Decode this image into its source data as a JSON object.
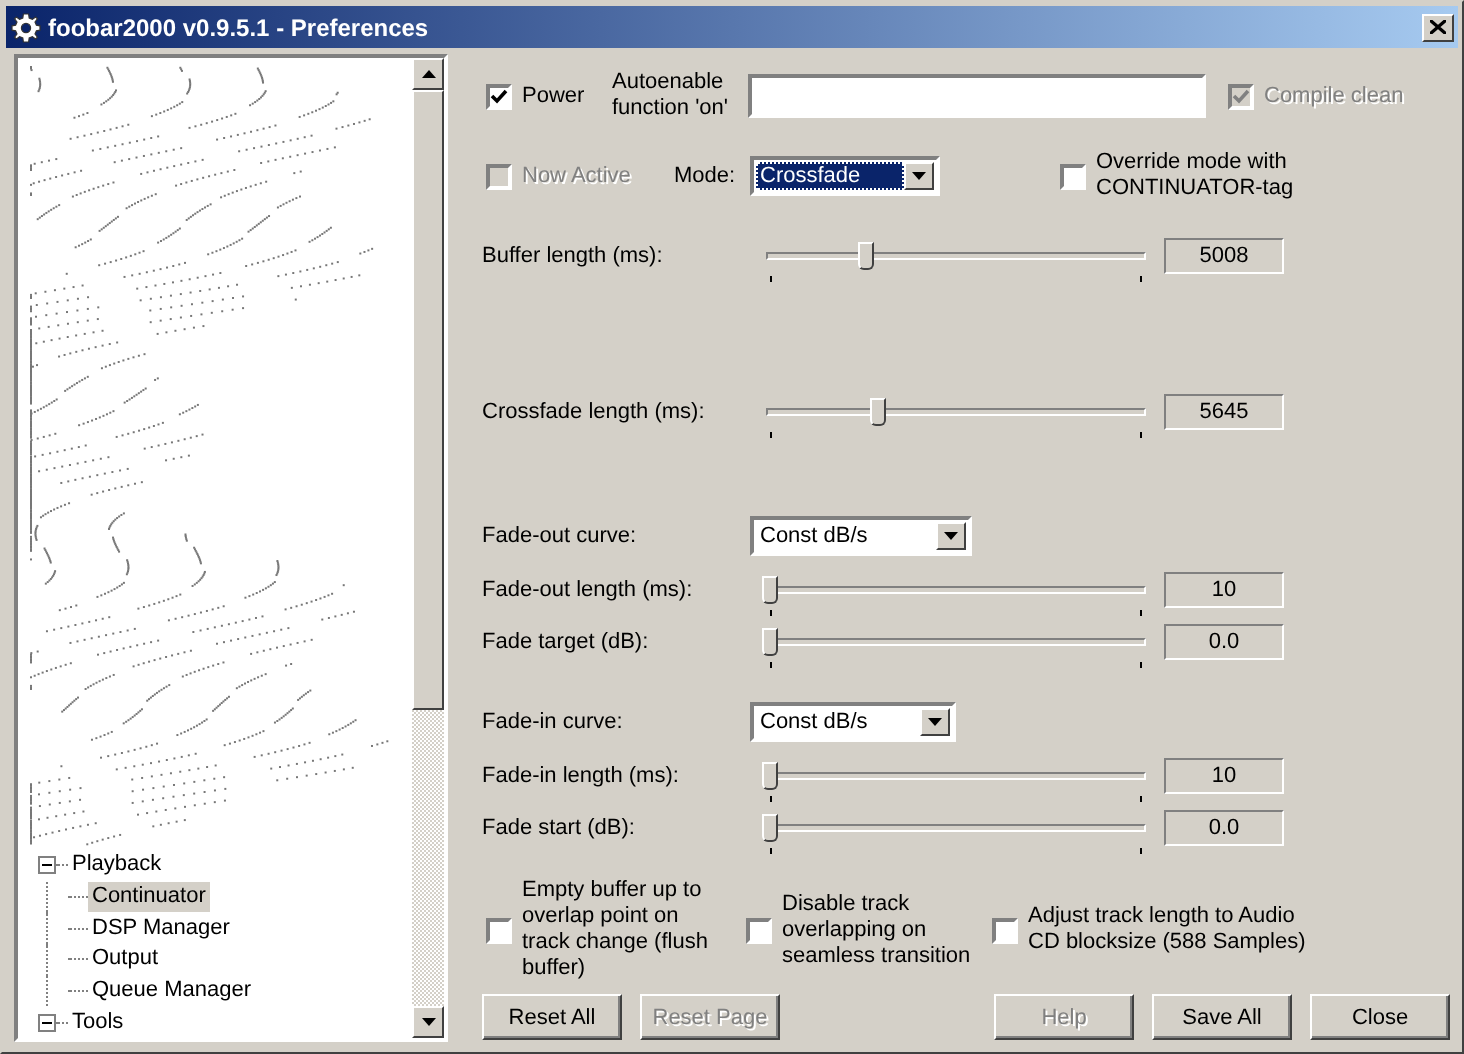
{
  "window": {
    "title": "foobar2000 v0.9.5.1 - Preferences"
  },
  "tree": [
    {
      "label": "Playback",
      "expanded": true,
      "selected": false,
      "children": [
        {
          "label": "Continuator",
          "selected": true
        },
        {
          "label": "DSP Manager",
          "selected": false
        },
        {
          "label": "Output",
          "selected": false
        },
        {
          "label": "Queue Manager",
          "selected": false
        }
      ]
    },
    {
      "label": "Tools",
      "expanded": true,
      "selected": false
    }
  ],
  "power": {
    "label": "Power",
    "checked": true
  },
  "autoenable": {
    "label": "Autoenable function 'on'"
  },
  "compile_clean": {
    "label": "Compile clean",
    "checked": true,
    "disabled": true
  },
  "now_active": {
    "label": "Now Active",
    "checked": false,
    "disabled": true
  },
  "mode": {
    "label": "Mode:",
    "value": "Crossfade"
  },
  "override": {
    "label": "Override mode with CONTINUATOR-tag",
    "checked": false
  },
  "groups": [
    [
      {
        "kind": "slider",
        "label": "Buffer length (ms):",
        "level": 0.26,
        "reading": "5008"
      }
    ],
    [
      {
        "kind": "slider",
        "label": "Crossfade length (ms):",
        "level": 0.29,
        "reading": "5645"
      }
    ],
    [
      {
        "kind": "dropdown",
        "label": "Fade-out curve:",
        "value": "Const dB/s"
      },
      {
        "kind": "slider",
        "label": "Fade-out length (ms):",
        "level": 0,
        "reading": "10"
      },
      {
        "kind": "slider",
        "label": "Fade target (dB):",
        "level": 0,
        "reading": "0.0"
      }
    ],
    [
      {
        "kind": "dropdown",
        "label": "Fade-in curve:",
        "value": "Const dB/s"
      },
      {
        "kind": "slider",
        "label": "Fade-in length (ms):",
        "level": 0,
        "reading": "10"
      },
      {
        "kind": "slider",
        "label": "Fade start (dB):",
        "level": 0,
        "reading": "0.0"
      }
    ]
  ],
  "options": [
    {
      "label": "Empty buffer up to overlap point on track change (flush buffer)",
      "checked": false
    },
    {
      "label": "Disable track overlapping on seamless transition",
      "checked": false
    },
    {
      "label": "Adjust track length to Audio CD blocksize (588 Samples)",
      "checked": false
    }
  ],
  "buttons_left": [
    {
      "label": "Reset All",
      "disabled": false
    },
    {
      "label": "Reset Page",
      "disabled": true
    }
  ],
  "buttons_right": [
    {
      "label": "Help",
      "disabled": true
    },
    {
      "label": "Save All",
      "disabled": false
    },
    {
      "label": "Close",
      "disabled": false
    }
  ]
}
